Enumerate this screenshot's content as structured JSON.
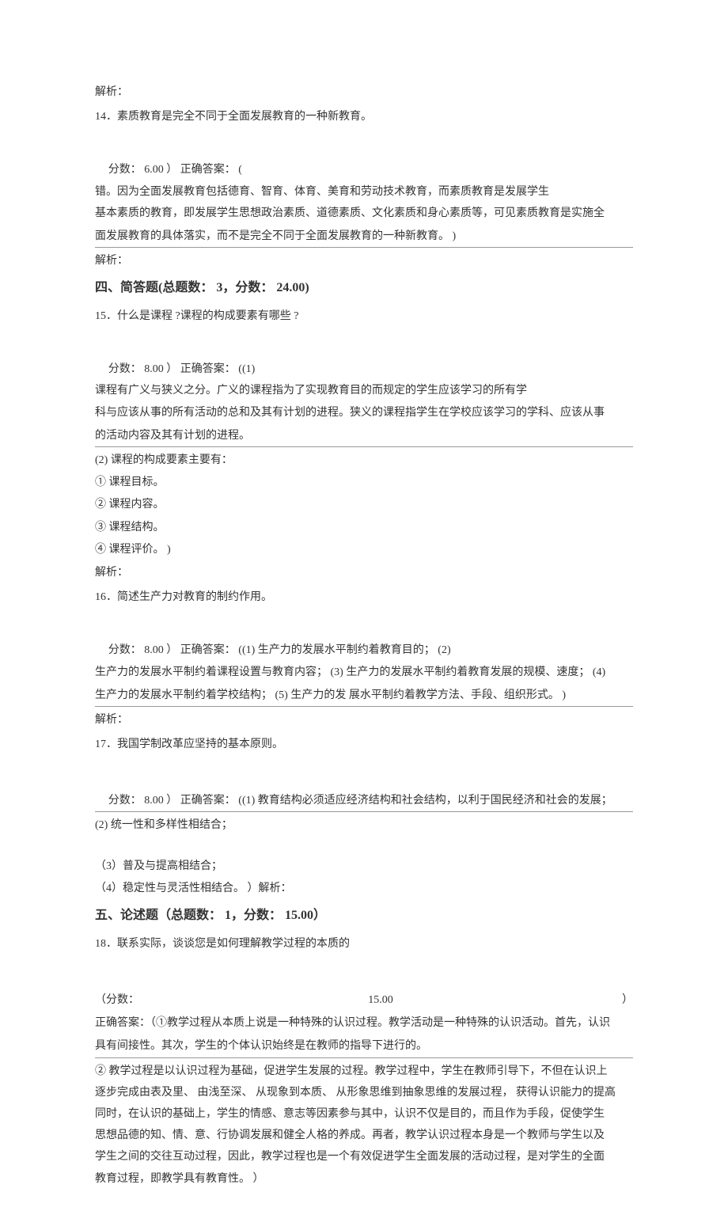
{
  "q14": {
    "analysis_label": "解析：",
    "title": "14．素质教育是完全不同于全面发展教育的一种新教育。",
    "score_line": "分数：  6.00 ） 正确答案：  (",
    "answer_l1": "错。因为全面发展教育包括德育、智育、体育、美育和劳动技术教育，而素质教育是发展学生",
    "answer_l2": "基本素质的教育，即发展学生思想政治素质、道德素质、文化素质和身心素质等，可见素质教育是实施全",
    "answer_l3": "面发展教育的具体落实，而不是完全不同于全面发展教育的一种新教育。  )",
    "analysis_end": "解析："
  },
  "sec4": {
    "title": "四、简答题(总题数：  3，分数：  24.00)"
  },
  "q15": {
    "title": "15．什么是课程 ?课程的构成要素有哪些  ?",
    "score_line": "分数：  8.00 ） 正确答案：  ((1)",
    "ans_l1": "课程有广义与狭义之分。广义的课程指为了实现教育目的而规定的学生应该学习的所有学",
    "ans_l2": "科与应该从事的所有活动的总和及其有计划的进程。狭义的课程指学生在学校应该学习的学科、应该从事",
    "ans_l3": "的活动内容及其有计划的进程。",
    "part2": "(2)  课程的构成要素主要有：",
    "i1": "①      课程目标。",
    "i2": "②      课程内容。",
    "i3": "③      课程结构。",
    "i4": "④      课程评价。  )",
    "analysis_end": "解析："
  },
  "q16": {
    "title": "16．简述生产力对教育的制约作用。",
    "score_line": "分数：  8.00 ） 正确答案：  ((1) 生产力的发展水平制约着教育目的；  (2)",
    "ans_l1": "生产力的发展水平制约着课程设置与教育内容；  (3) 生产力的发展水平制约着教育发展的规模、速度；  (4)",
    "ans_l2": "生产力的发展水平制约着学校结构；  (5) 生产力的发  展水平制约着教学方法、手段、组织形式。  )",
    "analysis_end": "解析："
  },
  "q17": {
    "title": "17．我国学制改革应坚持的基本原则。",
    "score_line": "分数：  8.00 ） 正确答案：  ((1) 教育结构必须适应经济结构和社会结构，以利于国民经济和社会的发展；",
    "i2": "(2)  统一性和多样性相结合；",
    "i3": "（3）普及与提高相结合；",
    "i4": "（4）稳定性与灵活性相结合。    ）解析："
  },
  "sec5": {
    "title": "五、论述题（总题数：  1，分数：  15.00）"
  },
  "q18": {
    "title": "18．联系实际，谈谈您是如何理解教学过程的本质的",
    "score_left": "（分数：",
    "score_mid": "15.00",
    "score_right": "）",
    "ans_l1": "正确答案：（①教学过程从本质上说是一种特殊的认识过程。教学活动是一种特殊的认识活动。首先，认识",
    "ans_l2": "具有间接性。其次，学生的个体认识始终是在教师的指导下进行的。",
    "p2_l1": "②      教学过程是以认识过程为基础，促进学生发展的过程。教学过程中，学生在教师引导下，不但在认识上",
    "p2_l2": "逐步完成由表及里、  由浅至深、  从现象到本质、  从形象思维到抽象思维的发展过程，  获得认识能力的提高",
    "p2_l3": "同时，在认识的基础上，学生的情感、意志等因素参与其中，认识不仅是目的，而且作为手段，促使学生",
    "p2_l4": "思想品德的知、情、意、行协调发展和健全人格的养成。再者，教学认识过程本身是一个教师与学生以及",
    "p2_l5": "学生之间的交往互动过程，因此，教学过程也是一个有效促进学生全面发展的活动过程，是对学生的全面",
    "p2_l6": "教育过程，即教学具有教育性。  ）"
  }
}
